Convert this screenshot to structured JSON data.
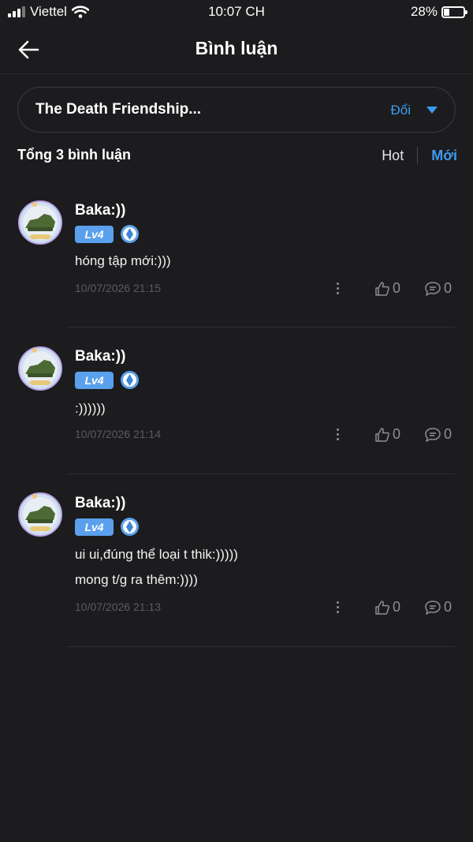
{
  "status_bar": {
    "carrier": "Viettel",
    "time": "10:07 CH",
    "battery": "28%"
  },
  "header": {
    "title": "Bình luận"
  },
  "selector": {
    "title": "The Death Friendship...",
    "change_label": "Đổi"
  },
  "summary": {
    "total_label": "Tổng 3 bình luận"
  },
  "sort": {
    "hot_label": "Hot",
    "new_label": "Mới",
    "active": "Mới"
  },
  "colors": {
    "accent": "#3d9bf0",
    "background": "#1c1c1e",
    "level_badge": "#5aa0ec"
  },
  "comments": [
    {
      "name": "Baka:))",
      "level": "Lv4",
      "lines": [
        "hóng tập mới:)))"
      ],
      "time": "10/07/2026 21:15",
      "likes": "0",
      "replies": "0"
    },
    {
      "name": "Baka:))",
      "level": "Lv4",
      "lines": [
        ":))))))"
      ],
      "time": "10/07/2026 21:14",
      "likes": "0",
      "replies": "0"
    },
    {
      "name": "Baka:))",
      "level": "Lv4",
      "lines": [
        "ui ui,đúng thể loại t thik:)))))",
        "mong t/g ra thêm:))))"
      ],
      "time": "10/07/2026 21:13",
      "likes": "0",
      "replies": "0"
    }
  ]
}
